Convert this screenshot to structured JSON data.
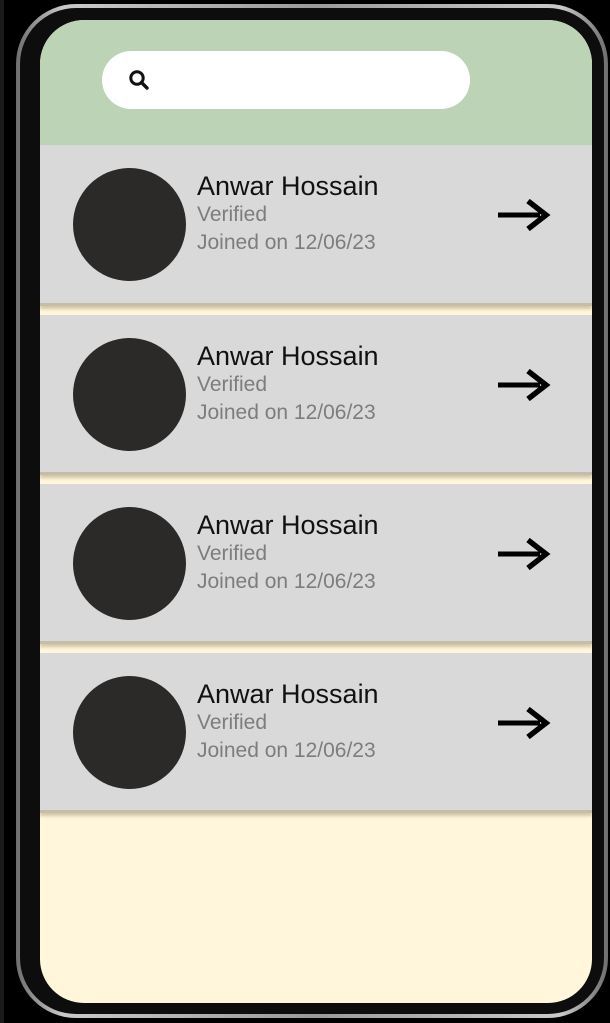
{
  "search": {
    "placeholder": "",
    "value": "",
    "icon": "search-icon"
  },
  "users": [
    {
      "name": "Anwar Hossain",
      "status": "Verified",
      "joined": "Joined on 12/06/23",
      "action_icon": "arrow-right-icon"
    },
    {
      "name": "Anwar Hossain",
      "status": "Verified",
      "joined": "Joined on 12/06/23",
      "action_icon": "arrow-right-icon"
    },
    {
      "name": "Anwar Hossain",
      "status": "Verified",
      "joined": "Joined on 12/06/23",
      "action_icon": "arrow-right-icon"
    },
    {
      "name": "Anwar Hossain",
      "status": "Verified",
      "joined": "Joined on 12/06/23",
      "action_icon": "arrow-right-icon"
    }
  ],
  "colors": {
    "header": "#bdd3b5",
    "background": "#fff6dc",
    "card": "#d9d9d9",
    "avatar": "#2b2a28"
  }
}
